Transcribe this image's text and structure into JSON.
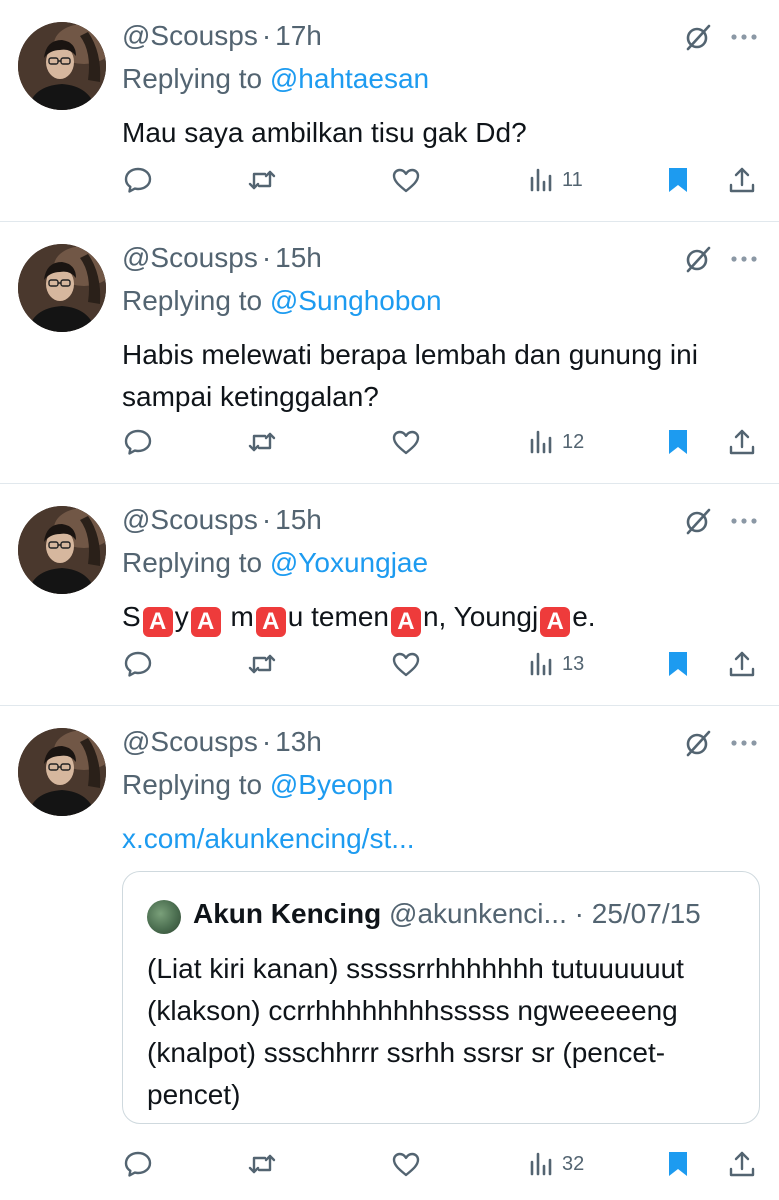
{
  "tweets": [
    {
      "handle": "@Scousps",
      "time": "17h",
      "replying_label": "Replying to",
      "mention": "@hahtaesan",
      "text": "Mau saya ambilkan tisu gak Dd?",
      "views": "11"
    },
    {
      "handle": "@Scousps",
      "time": "15h",
      "replying_label": "Replying to",
      "mention": "@Sunghobon",
      "text": "Habis melewati berapa lembah dan gunung ini sampai ketinggalan?",
      "views": "12"
    },
    {
      "handle": "@Scousps",
      "time": "15h",
      "replying_label": "Replying to",
      "mention": "@Yoxungjae",
      "text_parts": [
        "S",
        "A",
        "y",
        "A",
        "m",
        "A",
        "u temen",
        "A",
        "n, Youngj",
        "A",
        "e."
      ],
      "views": "13"
    },
    {
      "handle": "@Scousps",
      "time": "13h",
      "replying_label": "Replying to",
      "mention": "@Byeopn",
      "link": "x.com/akunkencing/st...",
      "views": "32"
    }
  ],
  "quote": {
    "name": "Akun Kencing",
    "handle": "@akunkenci...",
    "date": "25/07/15",
    "text": "(Liat kiri kanan) sssssrrhhhhhhh tutuuuuuut (klakson) ccrrhhhhhhhhsssss ngweeeeeng (knalpot) ssschhrrr ssrhh ssrsr sr (pencet-pencet)"
  },
  "separator": "·",
  "colors": {
    "text": "#0f1419",
    "secondary": "#536471",
    "link": "#1d9bf0",
    "bookmark": "#1d9bf0",
    "emoji_bg": "#ee3b3b",
    "divider": "#e1e8ed"
  },
  "icons": [
    "reply-icon",
    "retweet-icon",
    "like-icon",
    "views-icon",
    "bookmark-icon",
    "share-icon",
    "grok-icon",
    "more-icon"
  ]
}
